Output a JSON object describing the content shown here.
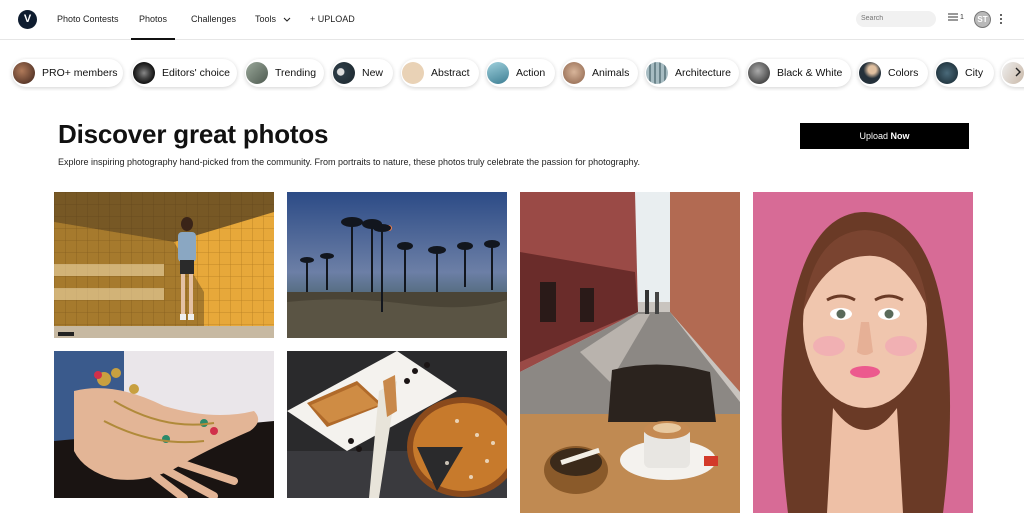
{
  "nav": {
    "logo_letter": "V",
    "items": [
      "Photo Contests",
      "Photos",
      "Challenges",
      "Tools",
      "+ UPLOAD"
    ],
    "active": "Photos",
    "search_placeholder": "Search",
    "menu_count": "1",
    "avatar_initials": "ST"
  },
  "categories": [
    {
      "label": "PRO+ members",
      "icon": "pro-members-thumb",
      "color": "#7a4a3a"
    },
    {
      "label": "Editors' choice",
      "icon": "editors-choice-thumb",
      "color": "#1e1e1e"
    },
    {
      "label": "Trending",
      "icon": "trending-thumb",
      "color": "#6b7a6a"
    },
    {
      "label": "New",
      "icon": "new-thumb",
      "color": "#2b3a44"
    },
    {
      "label": "Abstract",
      "icon": "abstract-thumb",
      "color": "#e8cfb2"
    },
    {
      "label": "Action",
      "icon": "action-thumb",
      "color": "#6aa7b8"
    },
    {
      "label": "Animals",
      "icon": "animals-thumb",
      "color": "#b98a6e"
    },
    {
      "label": "Architecture",
      "icon": "architecture-thumb",
      "color": "#8aa0a6"
    },
    {
      "label": "Black & White",
      "icon": "black-white-thumb",
      "color": "#3a3a3a"
    },
    {
      "label": "Colors",
      "icon": "colors-thumb",
      "color": "#24303a"
    },
    {
      "label": "City",
      "icon": "city-thumb",
      "color": "#1f3a4a"
    }
  ],
  "hero": {
    "title": "Discover great photos",
    "subtitle": "Explore inspiring photography hand-picked from the community. From portraits to nature, these photos truly celebrate the passion for photography.",
    "upload_label": "Upload",
    "upload_label_bold": "Now"
  },
  "photos": [
    {
      "subject": "woman-against-yellow-tile-wall"
    },
    {
      "subject": "palm-trees-at-dusk"
    },
    {
      "subject": "street-cafe-coffee"
    },
    {
      "subject": "portrait-woman-pink-background"
    },
    {
      "subject": "hand-with-jewelry"
    },
    {
      "subject": "pie-on-plate"
    }
  ]
}
